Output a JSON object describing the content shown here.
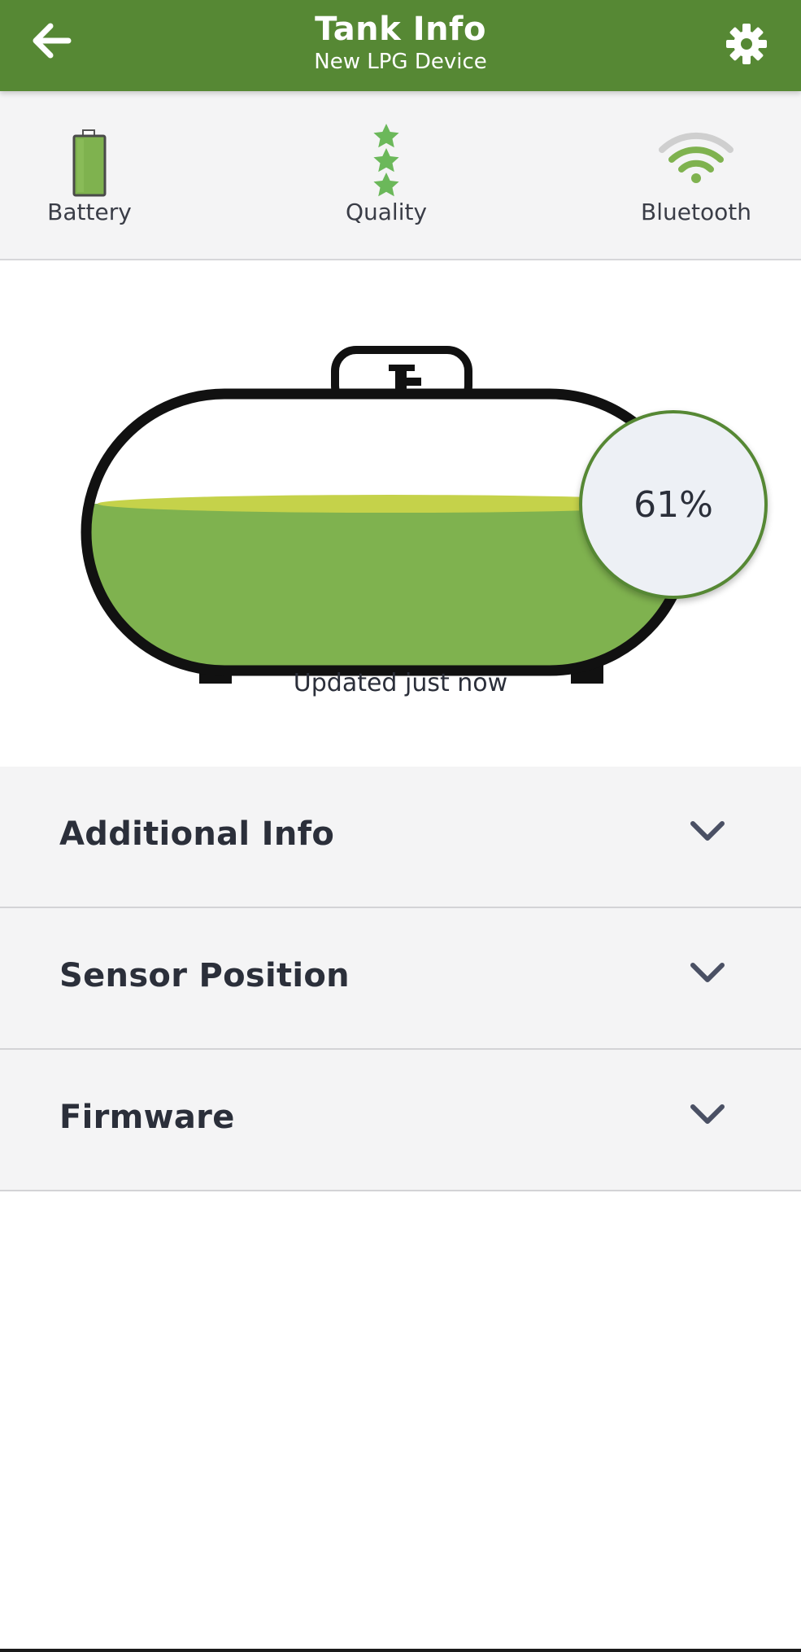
{
  "header": {
    "title": "Tank Info",
    "subtitle": "New LPG Device",
    "back_icon": "arrow-left-icon",
    "settings_icon": "gear-icon",
    "background_color": "#568834"
  },
  "status": {
    "battery": {
      "label": "Battery",
      "icon": "battery-icon",
      "color": "#7fb24f"
    },
    "quality": {
      "label": "Quality",
      "icon": "stars-icon",
      "stars": 3,
      "color": "#6bb85a"
    },
    "bluetooth": {
      "label": "Bluetooth",
      "icon": "signal-icon",
      "color": "#7fb24f"
    }
  },
  "tank": {
    "fill_percent": 61,
    "percent_label": "61%",
    "updated_text": "Updated just now",
    "fill_color": "#7fb24f",
    "surface_color": "#c5d24a"
  },
  "accordion": {
    "items": [
      {
        "label": "Additional Info"
      },
      {
        "label": "Sensor Position"
      },
      {
        "label": "Firmware"
      }
    ]
  }
}
